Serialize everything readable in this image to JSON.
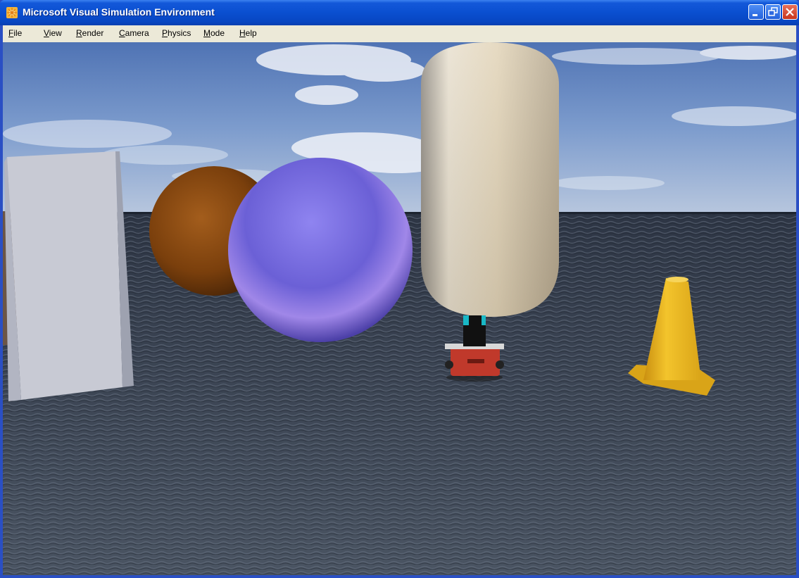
{
  "window": {
    "title": "Microsoft Visual Simulation Environment",
    "buttons": [
      "minimize",
      "restore",
      "close"
    ]
  },
  "menubar": {
    "items": [
      {
        "label": "File",
        "key": "F"
      },
      {
        "label": "View",
        "key": "V"
      },
      {
        "label": "Render",
        "key": "R"
      },
      {
        "label": "Camera",
        "key": "C"
      },
      {
        "label": "Physics",
        "key": "P"
      },
      {
        "label": "Mode",
        "key": "M"
      },
      {
        "label": "Help",
        "key": "H"
      }
    ]
  },
  "scene": {
    "objects": [
      "box",
      "wooden-sphere",
      "blue-sphere",
      "capsule",
      "robot",
      "traffic-cone"
    ],
    "colors": {
      "sky": "#6a8fc8",
      "ground": "#3a4250",
      "box": "#c9ccd6",
      "wood": "#8a4a12",
      "blue_sphere": "#7c6fe0",
      "capsule": "#d9cdb5",
      "cone": "#e8b820",
      "robot": "#c0392b"
    }
  }
}
